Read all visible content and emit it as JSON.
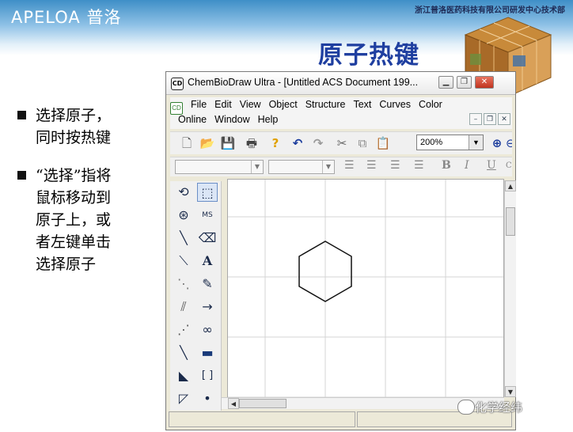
{
  "slide": {
    "logo": "APELOA 普洛",
    "company": "浙江普洛医药科技有限公司研发中心技术部",
    "title": "原子热键",
    "bullets": [
      "选择原子，\n同时按热键",
      "“选择”指将\n鼠标移动到\n原子上，或\n者左键单击\n选择原子"
    ],
    "watermark": "化学经纬"
  },
  "window": {
    "app_icon": "CD",
    "title": "ChemBioDraw Ultra - [Untitled ACS Document 199...",
    "controls": [
      "minimize-icon",
      "restore-icon",
      "close-icon"
    ],
    "menu_row1": [
      "File",
      "Edit",
      "View",
      "Object",
      "Structure",
      "Text",
      "Curves",
      "Color"
    ],
    "menu_row2": [
      "Online",
      "Window",
      "Help"
    ],
    "zoom_value": "200%",
    "font_format_buttons": [
      "B",
      "I",
      "U",
      "C"
    ],
    "palette_text_tool": "A",
    "palette_bracket_tool": "[ ]",
    "palette_mass_label": "MS"
  },
  "colors": {
    "title_blue": "#1f3fa0",
    "header_blue": "#3f8fc7"
  }
}
